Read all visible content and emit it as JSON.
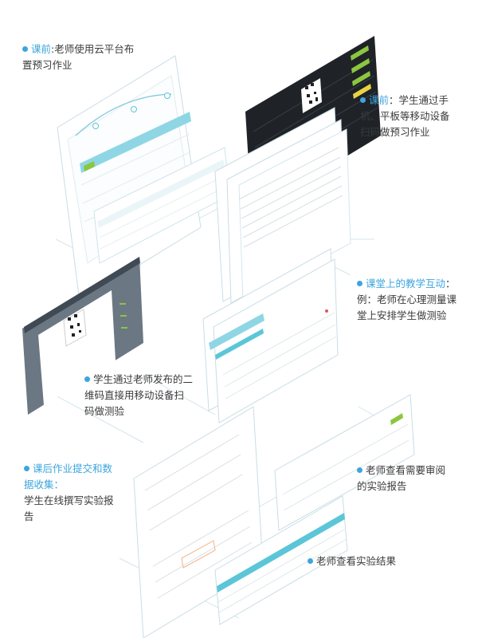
{
  "annotations": [
    {
      "id": "before-class-teacher",
      "highlight": "课前",
      "rest": ":老师使用云平台布",
      "lines": [
        "置预习作业"
      ]
    },
    {
      "id": "before-class-students",
      "highlight": "课前",
      "rest": "：学生通过手",
      "lines": [
        "机、平板等移动设备",
        "扫码做预习作业"
      ]
    },
    {
      "id": "in-class-interaction",
      "highlight": "课堂上的教学互动",
      "rest": "：",
      "lines": [
        "例：老师在心理测量课",
        "堂上安排学生做测验"
      ]
    },
    {
      "id": "qr-test",
      "highlight": "",
      "rest": "学生通过老师发布的二",
      "lines": [
        "维码直接用移动设备扫",
        "码做测验"
      ]
    },
    {
      "id": "after-class-submission",
      "highlight": "课后作业提交和数",
      "rest": "",
      "lines": [
        "据收集：",
        "学生在线撰写实验报",
        "告"
      ]
    },
    {
      "id": "teacher-review-reports",
      "highlight": "",
      "rest": "老师查看需要审阅",
      "lines": [
        "的实验报告"
      ]
    },
    {
      "id": "teacher-view-results",
      "highlight": "",
      "rest": "老师查看实验结果",
      "lines": []
    }
  ],
  "colors": {
    "accent": "#3da5dd",
    "teal": "#5cc6d8",
    "dark": "#1f2328",
    "panel": "#6b7782",
    "line": "#cfe3ea",
    "green": "#8cc63f",
    "yellow": "#e8d441"
  }
}
